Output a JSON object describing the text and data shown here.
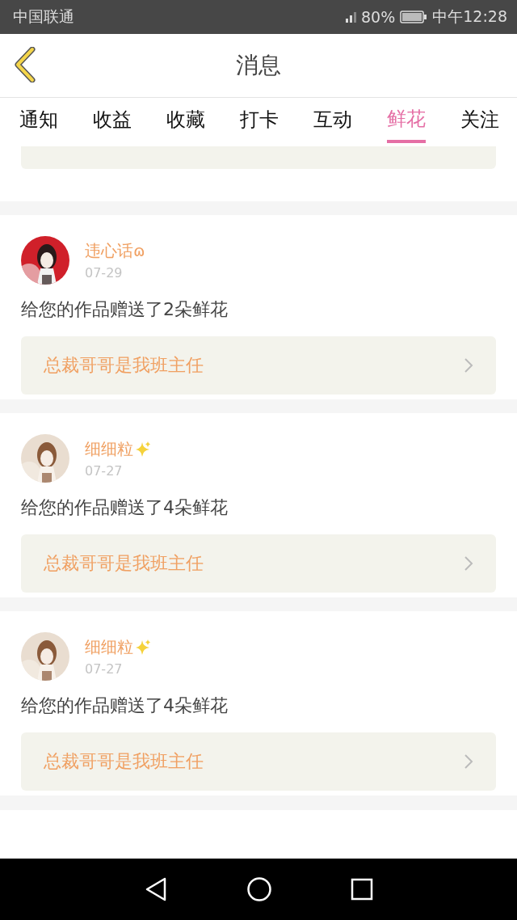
{
  "status_bar": {
    "carrier": "中国联通",
    "battery": "80%",
    "time": "中午12:28"
  },
  "header": {
    "title": "消息"
  },
  "tabs": [
    {
      "label": "通知",
      "selected": false
    },
    {
      "label": "收益",
      "selected": false
    },
    {
      "label": "收藏",
      "selected": false
    },
    {
      "label": "打卡",
      "selected": false
    },
    {
      "label": "互动",
      "selected": false
    },
    {
      "label": "鲜花",
      "selected": true
    },
    {
      "label": "关注",
      "selected": false
    }
  ],
  "messages": [
    {
      "user": "违心话ɷ",
      "sparkle": false,
      "date": "07-29",
      "text": "给您的作品赠送了2朵鲜花",
      "work": "总裁哥哥是我班主任"
    },
    {
      "user": "细细粒",
      "sparkle": true,
      "date": "07-27",
      "text": "给您的作品赠送了4朵鲜花",
      "work": "总裁哥哥是我班主任"
    },
    {
      "user": "细细粒",
      "sparkle": true,
      "date": "07-27",
      "text": "给您的作品赠送了4朵鲜花",
      "work": "总裁哥哥是我班主任"
    }
  ]
}
